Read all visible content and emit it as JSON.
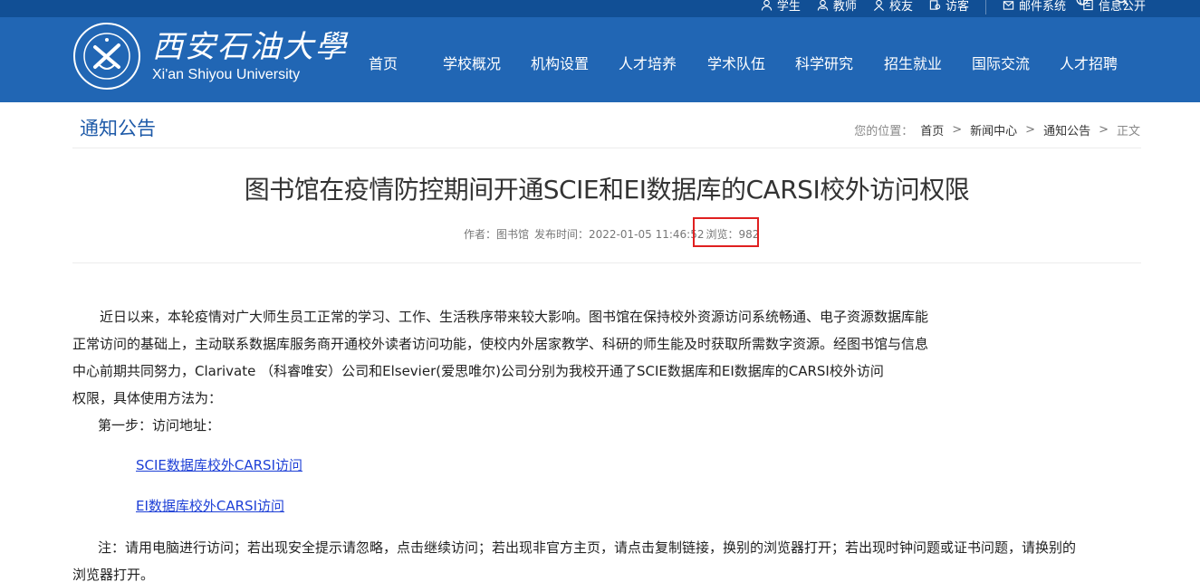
{
  "header": {
    "top_links": [
      {
        "label": "学生",
        "icon": "user-icon"
      },
      {
        "label": "教师",
        "icon": "teacher-icon"
      },
      {
        "label": "校友",
        "icon": "alumni-icon"
      },
      {
        "label": "访客",
        "icon": "visitor-icon"
      }
    ],
    "top_links_right": [
      {
        "label": "邮件系统",
        "icon": "mail-icon"
      },
      {
        "label": "信息公开",
        "icon": "document-icon"
      }
    ],
    "brand_cn": "西安石油大學",
    "brand_en": "Xi'an Shiyou University",
    "nav": [
      "首页",
      "学校概况",
      "机构设置",
      "人才培养",
      "学术队伍",
      "科学研究",
      "招生就业",
      "国际交流",
      "人才招聘"
    ],
    "colors": {
      "header_bg": "#2166b4",
      "topbar_bg": "#114f95"
    }
  },
  "section": {
    "title": "通知公告",
    "breadcrumb_label": "您的位置：",
    "breadcrumb": [
      "首页",
      "新闻中心",
      "通知公告",
      "正文"
    ],
    "breadcrumb_sep": ">"
  },
  "article": {
    "title": "图书馆在疫情防控期间开通SCIE和EI数据库的CARSI校外访问权限",
    "meta_author": "作者：图书馆",
    "meta_time": "发布时间：2022-01-05 11:46:52",
    "meta_views": "浏览：982",
    "paragraph_lines": [
      "　　近日以来，本轮疫情对广大师生员工正常的学习、工作、生活秩序带来较大影响。图书馆在保持校外资源访问系统畅通、电子资源数据库能",
      "正常访问的基础上，主动联系数据库服务商开通校外读者访问功能，使校内外居家教学、科研的师生能及时获取所需数字资源。经图书馆与信息",
      "中心前期共同努力，Clarivate （科睿唯安）公司和Elsevier(爱思唯尔)公司分别为我校开通了SCIE数据库和EI数据库的CARSI校外访问",
      "权限，具体使用方法为："
    ],
    "step1": "第一步：访问地址：",
    "links": [
      "SCIE数据库校外CARSI访问",
      "EI数据库校外CARSI访问"
    ],
    "note_lines": [
      "注：请用电脑进行访问；若出现安全提示请忽略，点击继续访问；若出现非官方主页，请点击复制链接，换别的浏览器打开；若出现时钟问题或证书问题，请换别的",
      "浏览器打开。"
    ],
    "highlight_color": "#e02020",
    "link_color": "#1d3fd6"
  }
}
